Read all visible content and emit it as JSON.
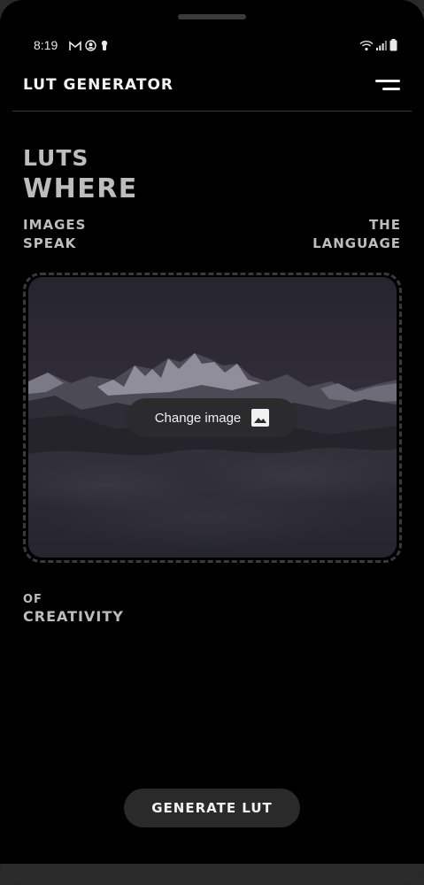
{
  "status_bar": {
    "time": "8:19",
    "left_icons": [
      "gmail-icon",
      "account-circle-icon",
      "keyhole-icon"
    ],
    "right_icons": [
      "wifi-icon",
      "signal-icon",
      "battery-icon"
    ]
  },
  "app_bar": {
    "title": "LUT GENERATOR",
    "menu_icon": "menu-icon"
  },
  "headline": {
    "line1": "LUTS",
    "line2": "WHERE"
  },
  "tagline": {
    "left_line1": "IMAGES",
    "left_line2": "SPEAK",
    "right_line1": "THE",
    "right_line2": "LANGUAGE",
    "bottom_line1": "OF",
    "bottom_line2": "CREATIVITY"
  },
  "image_picker": {
    "button_label": "Change image",
    "button_icon": "image-icon"
  },
  "actions": {
    "generate_label": "GENERATE LUT"
  },
  "colors": {
    "background": "#000000",
    "text": "#bdbdbd",
    "button": "#2a2a2a"
  }
}
